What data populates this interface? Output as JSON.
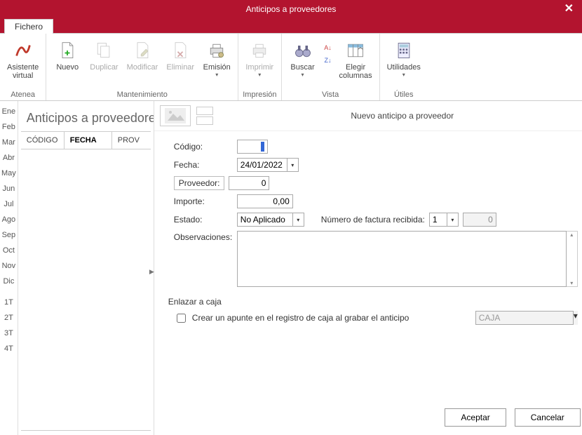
{
  "window": {
    "title": "Anticipos a proveedores"
  },
  "ribbon": {
    "fichero_tab": "Fichero",
    "groups": {
      "atenea": {
        "label": "Atenea",
        "asistente": "Asistente\nvirtual"
      },
      "mantenimiento": {
        "label": "Mantenimiento",
        "nuevo": "Nuevo",
        "duplicar": "Duplicar",
        "modificar": "Modificar",
        "eliminar": "Eliminar",
        "emision": "Emisión"
      },
      "impresion": {
        "label": "Impresión",
        "imprimir": "Imprimir"
      },
      "vista": {
        "label": "Vista",
        "buscar": "Buscar",
        "columnas": "Elegir\ncolumnas"
      },
      "utiles": {
        "label": "Útiles",
        "utilidades": "Utilidades"
      }
    }
  },
  "months": [
    "Ene",
    "Feb",
    "Mar",
    "Abr",
    "May",
    "Jun",
    "Jul",
    "Ago",
    "Sep",
    "Oct",
    "Nov",
    "Dic",
    "1T",
    "2T",
    "3T",
    "4T"
  ],
  "list": {
    "title": "Anticipos a proveedores",
    "col_codigo": "CÓDIGO",
    "col_fecha": "FECHA",
    "col_prov": "PROV"
  },
  "form": {
    "title": "Nuevo anticipo a proveedor",
    "labels": {
      "codigo": "Código:",
      "fecha": "Fecha:",
      "proveedor": "Proveedor:",
      "importe": "Importe:",
      "estado": "Estado:",
      "num_factura": "Número de factura recibida:",
      "observaciones": "Observaciones:",
      "enlazar": "Enlazar a caja",
      "crear_apunte": "Crear un apunte en el registro de caja al grabar el anticipo"
    },
    "values": {
      "codigo": "",
      "fecha": "24/01/2022",
      "proveedor": "0",
      "importe": "0,00",
      "estado": "No Aplicado",
      "factura_serie": "1",
      "factura_num": "0",
      "caja": "CAJA"
    }
  },
  "buttons": {
    "aceptar": "Aceptar",
    "cancelar": "Cancelar"
  },
  "colors": {
    "brand": "#b3142f"
  }
}
